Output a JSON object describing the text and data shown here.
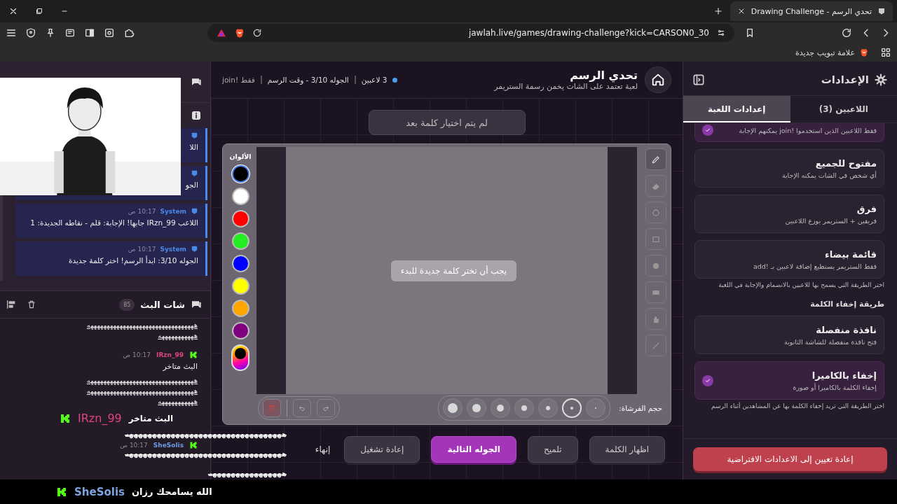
{
  "browser": {
    "tab_title": "Drawing Challenge - تحدي الرسم",
    "url": "jawlah.live/games/drawing-challenge?kick=CARSON0_30",
    "bookmark": "علامة تبويب جديدة"
  },
  "left_panel": {
    "system_messages": [
      {
        "text": "اللا"
      },
      {
        "text": "الجو"
      },
      {
        "author": "System",
        "time": "10:17 ص",
        "text": "اللاعب IRzn_99 جابها! الإجابة: قلم - نقاطه الجديدة: 1"
      },
      {
        "author": "System",
        "time": "10:17 ص",
        "text": "الجوله 3/10: ابدأ الرسم! اختر كلمة جديدة"
      }
    ],
    "stream_chat": {
      "title": "شات البث",
      "count": "85",
      "messages": [
        {
          "kind": "laugh",
          "text": "هههههههههههههههههههههههههههههههههه"
        },
        {
          "kind": "laugh",
          "text": "هههههههههههه"
        },
        {
          "kind": "message",
          "author": "IRzn_99",
          "color": "#e0457b",
          "time": "10:17 ص",
          "text": "البث متاخر"
        },
        {
          "kind": "laugh",
          "text": "هههههههههههههههههههههههههههههههههه"
        },
        {
          "kind": "laugh",
          "text": "هههههههههههههههههههههههههههههههههه"
        },
        {
          "kind": "laugh",
          "text": "هههههههههههه"
        },
        {
          "kind": "message",
          "author": "SheSolis",
          "color": "#6f9be0",
          "time": "10:17 ص"
        }
      ]
    }
  },
  "game": {
    "title": "تحدي الرسم",
    "subtitle": "لعبة تعتمد على الشات يخمن رسمة الستريمر",
    "status": [
      "3 لاعبين",
      "الجوله 3/10 - وقت الرسم",
      "فقط !join"
    ],
    "word_status": "لم يتم اختيار كلمة بعد",
    "tools": [
      {
        "kind": "pen",
        "selected": true
      },
      {
        "kind": "eraser",
        "selected": false
      },
      {
        "kind": "circle",
        "selected": false
      },
      {
        "kind": "square",
        "selected": false
      },
      {
        "kind": "dot",
        "selected": false
      },
      {
        "kind": "rect",
        "selected": false
      },
      {
        "kind": "hand",
        "selected": false
      },
      {
        "kind": "line",
        "selected": false
      }
    ],
    "colors_label": "الألوان",
    "colors": [
      {
        "kind": "swatch",
        "color": "#000000",
        "selected": true
      },
      {
        "kind": "swatch",
        "color": "#ffffff",
        "selected": false
      },
      {
        "kind": "swatch",
        "color": "#ff0000",
        "selected": false
      },
      {
        "kind": "swatch",
        "color": "#22ee22",
        "selected": false
      },
      {
        "kind": "swatch",
        "color": "#0000ff",
        "selected": false
      },
      {
        "kind": "swatch",
        "color": "#ffff00",
        "selected": false
      },
      {
        "kind": "swatch",
        "color": "#ffa500",
        "selected": false
      },
      {
        "kind": "swatch",
        "color": "#800080",
        "selected": false
      },
      {
        "kind": "picker",
        "selected": false
      }
    ],
    "canvas_message": "يجب أن تختر كلمة جديدة للبدء",
    "brush_label": "حجم الفرشاة:",
    "brush_sizes": [
      {
        "selected": false
      },
      {
        "selected": true
      },
      {
        "selected": false
      },
      {
        "selected": false
      },
      {
        "selected": false
      },
      {
        "selected": false
      },
      {
        "selected": false
      }
    ],
    "buttons": [
      {
        "label": "اظهار الكلمة",
        "kind": "secondary"
      },
      {
        "label": "تلميح",
        "kind": "secondary"
      },
      {
        "label": "الجوله التالية",
        "kind": "primary"
      },
      {
        "label": "إعادة تشغيل",
        "kind": "secondary"
      },
      {
        "label": "إنهاء",
        "kind": "text"
      }
    ]
  },
  "settings": {
    "title": "الإعدادات",
    "tabs": [
      {
        "label": "اللاعبين (3)",
        "selected": false
      },
      {
        "label": "إعدادات اللعبة",
        "selected": true
      }
    ],
    "join_modes": [
      {
        "description": "فقط اللاعبين الذين استخدموا !join يمكنهم الإجابة",
        "selected": true
      },
      {
        "title": "مفتوح للجميع",
        "description": "أي شخص في الشات يمكنه الإجابة",
        "selected": false
      },
      {
        "title": "فرق",
        "description": "فريقين + الستريمر يوزع اللاعبين",
        "selected": false
      },
      {
        "title": "قائمة بيضاء",
        "description": "فقط الستريمر يستطيع إضافة لاعبين بـ !add",
        "selected": false
      }
    ],
    "join_help": "اختر الطريقة التي يسمح بها للاعبين بالانضمام والإجابة في اللعبة",
    "hide_title": "طريقة إخفاء الكلمة",
    "hide_modes": [
      {
        "title": "نافذة منفصلة",
        "description": "فتح نافذة منفصلة للشاشة الثانوية",
        "selected": false
      },
      {
        "title": "إخفاء بالكاميرا",
        "description": "إخفاء الكلمة بالكاميرا أو صورة",
        "selected": true
      }
    ],
    "hide_help": "اختر الطريقة التي تريد إخفاء الكلمة بها عن المشاهدين أثناء الرسم",
    "reset_button": "إعادة تعيين إلى الاعدادات الافتراضية"
  },
  "overlays": {
    "name_tag": {
      "author": "IRzn_99",
      "text": "البث متاخر"
    },
    "laughs": [
      "ههههههههههههههههههههههههههههههههههه",
      "ههههههههههههههههههههههههههههههههههه",
      "ههههههههههههههههه"
    ],
    "ticker": {
      "author": "SheSolis",
      "text": "الله يسامحك رزان"
    }
  }
}
